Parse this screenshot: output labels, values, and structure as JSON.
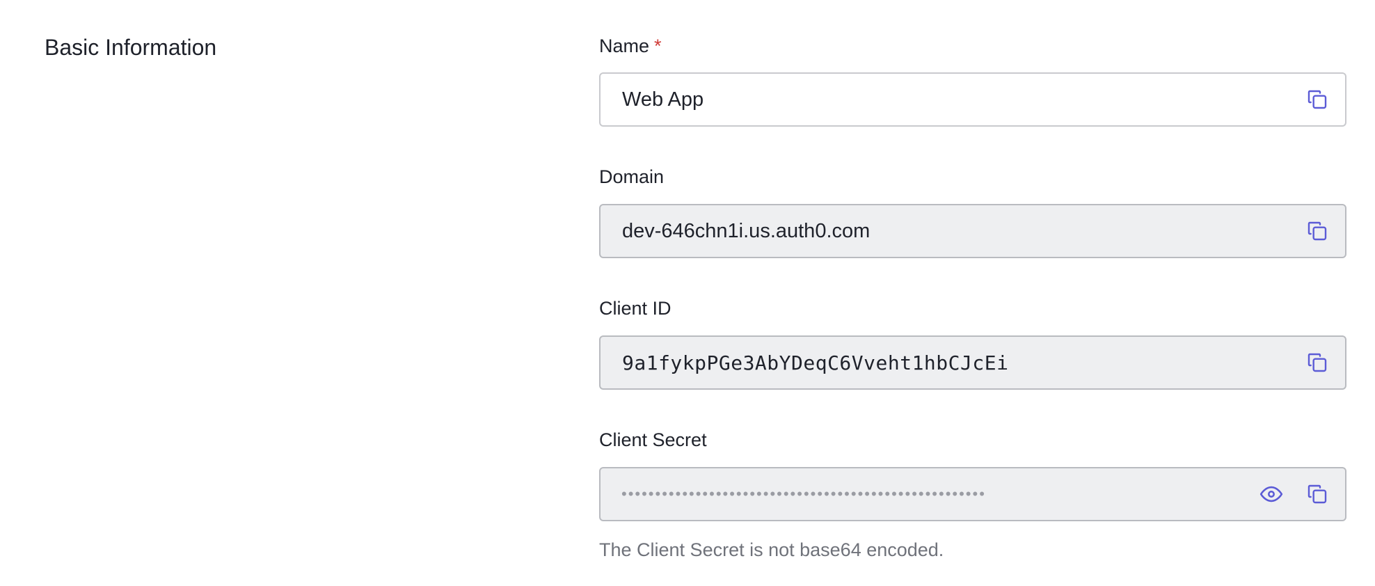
{
  "section": {
    "title": "Basic Information"
  },
  "fields": {
    "name": {
      "label": "Name",
      "required_mark": "*",
      "value": "Web App",
      "copy_icon": "copy-icon"
    },
    "domain": {
      "label": "Domain",
      "value": "dev-646chn1i.us.auth0.com",
      "copy_icon": "copy-icon"
    },
    "client_id": {
      "label": "Client ID",
      "value": "9a1fykpPGe3AbYDeqC6Vveht1hbCJcEi",
      "copy_icon": "copy-icon"
    },
    "client_secret": {
      "label": "Client Secret",
      "masked_value": "••••••••••••••••••••••••••••••••••••••••••••••••••••••",
      "reveal_icon": "eye-icon",
      "copy_icon": "copy-icon",
      "help_text": "The Client Secret is not base64 encoded."
    }
  },
  "colors": {
    "accent": "#5b5bd6",
    "required": "#d03c38",
    "readonly_bg": "#eeeff1",
    "border": "#c9cace",
    "text": "#1e212a",
    "muted": "#6f727a"
  }
}
